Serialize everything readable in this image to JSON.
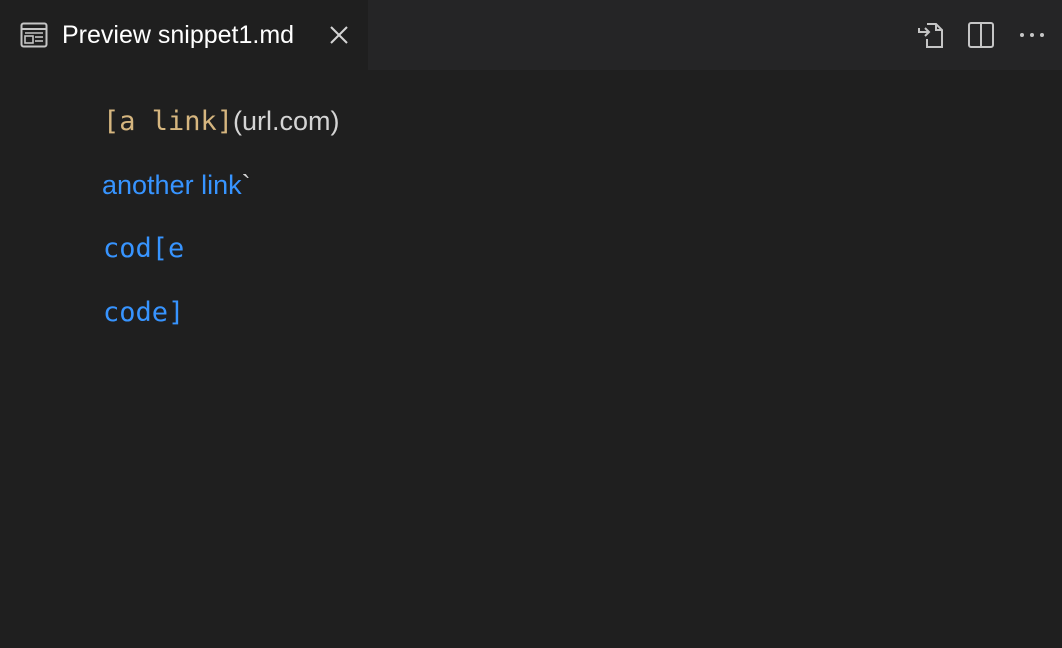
{
  "tab": {
    "icon": "preview-icon",
    "title": "Preview snippet1.md",
    "close_icon": "close-icon"
  },
  "toolbar": {
    "actions": [
      {
        "name": "open-source-icon"
      },
      {
        "name": "split-editor-icon"
      },
      {
        "name": "more-actions-icon"
      }
    ]
  },
  "preview": {
    "line1": {
      "code_text": "[a link]",
      "plain_text": "(url.com)"
    },
    "line2": {
      "link_text": "another link",
      "trailing_text": "`"
    },
    "line3": {
      "code_text": "cod[e"
    },
    "line4": {
      "code_text": "code]"
    }
  },
  "colors": {
    "background": "#1f1f1f",
    "tabbar": "#252526",
    "code_gold": "#d6b67f",
    "link_blue": "#3794ff",
    "text": "#d4d4d4"
  }
}
